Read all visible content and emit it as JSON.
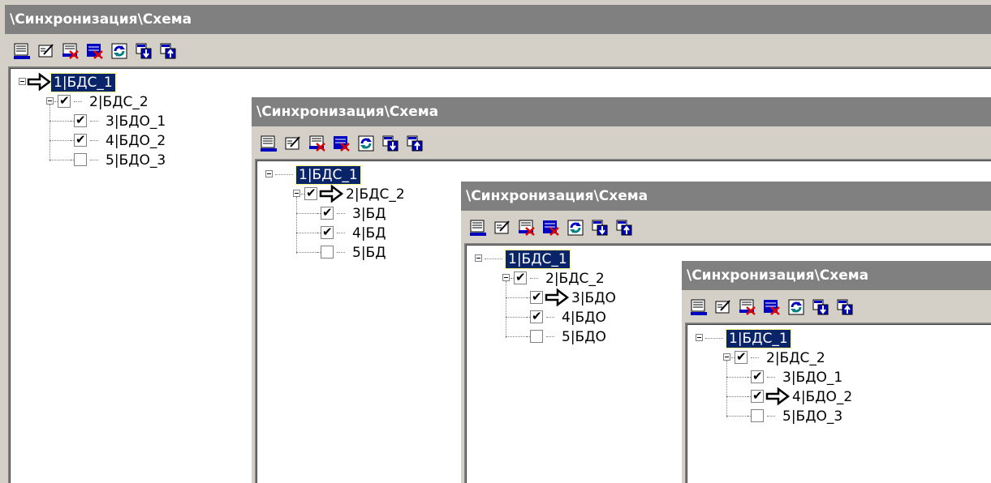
{
  "window": {
    "title": "\\Синхронизация\\Схема"
  },
  "toolbar": {
    "buttons": [
      {
        "icon": "list-icon"
      },
      {
        "icon": "edit-icon"
      },
      {
        "icon": "delete-record-icon"
      },
      {
        "icon": "delete-all-icon"
      },
      {
        "icon": "refresh-icon"
      },
      {
        "icon": "import-icon"
      },
      {
        "icon": "export-icon"
      }
    ]
  },
  "panels": [
    {
      "title": "\\Синхронизация\\Схема",
      "current_node": 1,
      "nodes": [
        {
          "label": "1|БДС_1",
          "level": 0,
          "checkbox": null,
          "selected": true
        },
        {
          "label": "2|БДС_2",
          "level": 1,
          "checkbox": true,
          "selected": false
        },
        {
          "label": "3|БДО_1",
          "level": 2,
          "checkbox": true,
          "selected": false
        },
        {
          "label": "4|БДО_2",
          "level": 2,
          "checkbox": true,
          "selected": false
        },
        {
          "label": "5|БДО_3",
          "level": 2,
          "checkbox": false,
          "selected": false
        }
      ]
    },
    {
      "title": "\\Синхронизация\\Схема",
      "current_node": 2,
      "nodes": [
        {
          "label": "1|БДС_1",
          "level": 0,
          "checkbox": null,
          "selected": true
        },
        {
          "label": "2|БДС_2",
          "level": 1,
          "checkbox": true,
          "selected": false
        },
        {
          "label": "3|БД",
          "level": 2,
          "checkbox": true,
          "selected": false
        },
        {
          "label": "4|БД",
          "level": 2,
          "checkbox": true,
          "selected": false
        },
        {
          "label": "5|БД",
          "level": 2,
          "checkbox": false,
          "selected": false
        }
      ]
    },
    {
      "title": "\\Синхронизация\\Схема",
      "current_node": 3,
      "nodes": [
        {
          "label": "1|БДС_1",
          "level": 0,
          "checkbox": null,
          "selected": true
        },
        {
          "label": "2|БДС_2",
          "level": 1,
          "checkbox": true,
          "selected": false
        },
        {
          "label": "3|БДО",
          "level": 2,
          "checkbox": true,
          "selected": false
        },
        {
          "label": "4|БДО",
          "level": 2,
          "checkbox": true,
          "selected": false
        },
        {
          "label": "5|БДО",
          "level": 2,
          "checkbox": false,
          "selected": false
        }
      ]
    },
    {
      "title": "\\Синхронизация\\Схема",
      "current_node": 4,
      "nodes": [
        {
          "label": "1|БДС_1",
          "level": 0,
          "checkbox": null,
          "selected": true
        },
        {
          "label": "2|БДС_2",
          "level": 1,
          "checkbox": true,
          "selected": false
        },
        {
          "label": "3|БДО_1",
          "level": 2,
          "checkbox": true,
          "selected": false
        },
        {
          "label": "4|БДО_2",
          "level": 2,
          "checkbox": true,
          "selected": false
        },
        {
          "label": "5|БДО_3",
          "level": 2,
          "checkbox": false,
          "selected": false
        }
      ]
    }
  ],
  "colors": {
    "titlebar_bg": "#808080",
    "selection_bg": "#0a246a",
    "chrome_bg": "#d4d0c8"
  }
}
